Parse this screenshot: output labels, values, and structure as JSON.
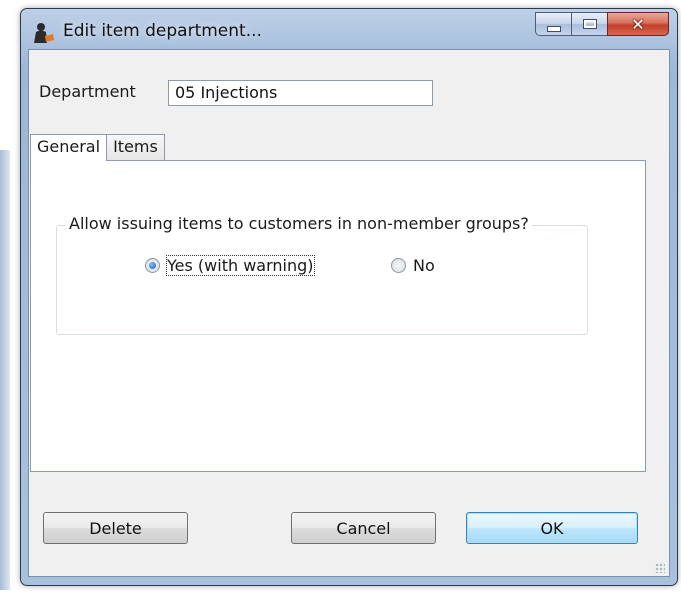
{
  "window": {
    "title": "Edit item department...",
    "icon": "person-icon",
    "controls": [
      "minimize-icon",
      "maximize-icon",
      "close-icon"
    ]
  },
  "department": {
    "label": "Department",
    "value": "05 Injections"
  },
  "tabs": [
    {
      "label": "General",
      "active": true
    },
    {
      "label": "Items",
      "active": false
    }
  ],
  "general": {
    "question": "Allow issuing items to customers in non-member groups?",
    "options": [
      {
        "label": "Yes (with warning)",
        "checked": true
      },
      {
        "label": "No",
        "checked": false
      }
    ]
  },
  "buttons": {
    "delete": "Delete",
    "cancel": "Cancel",
    "ok": "OK"
  },
  "colors": {
    "frame": "#a9c1dd",
    "close_button": "#c1412b",
    "default_button": "#bee6fd"
  }
}
